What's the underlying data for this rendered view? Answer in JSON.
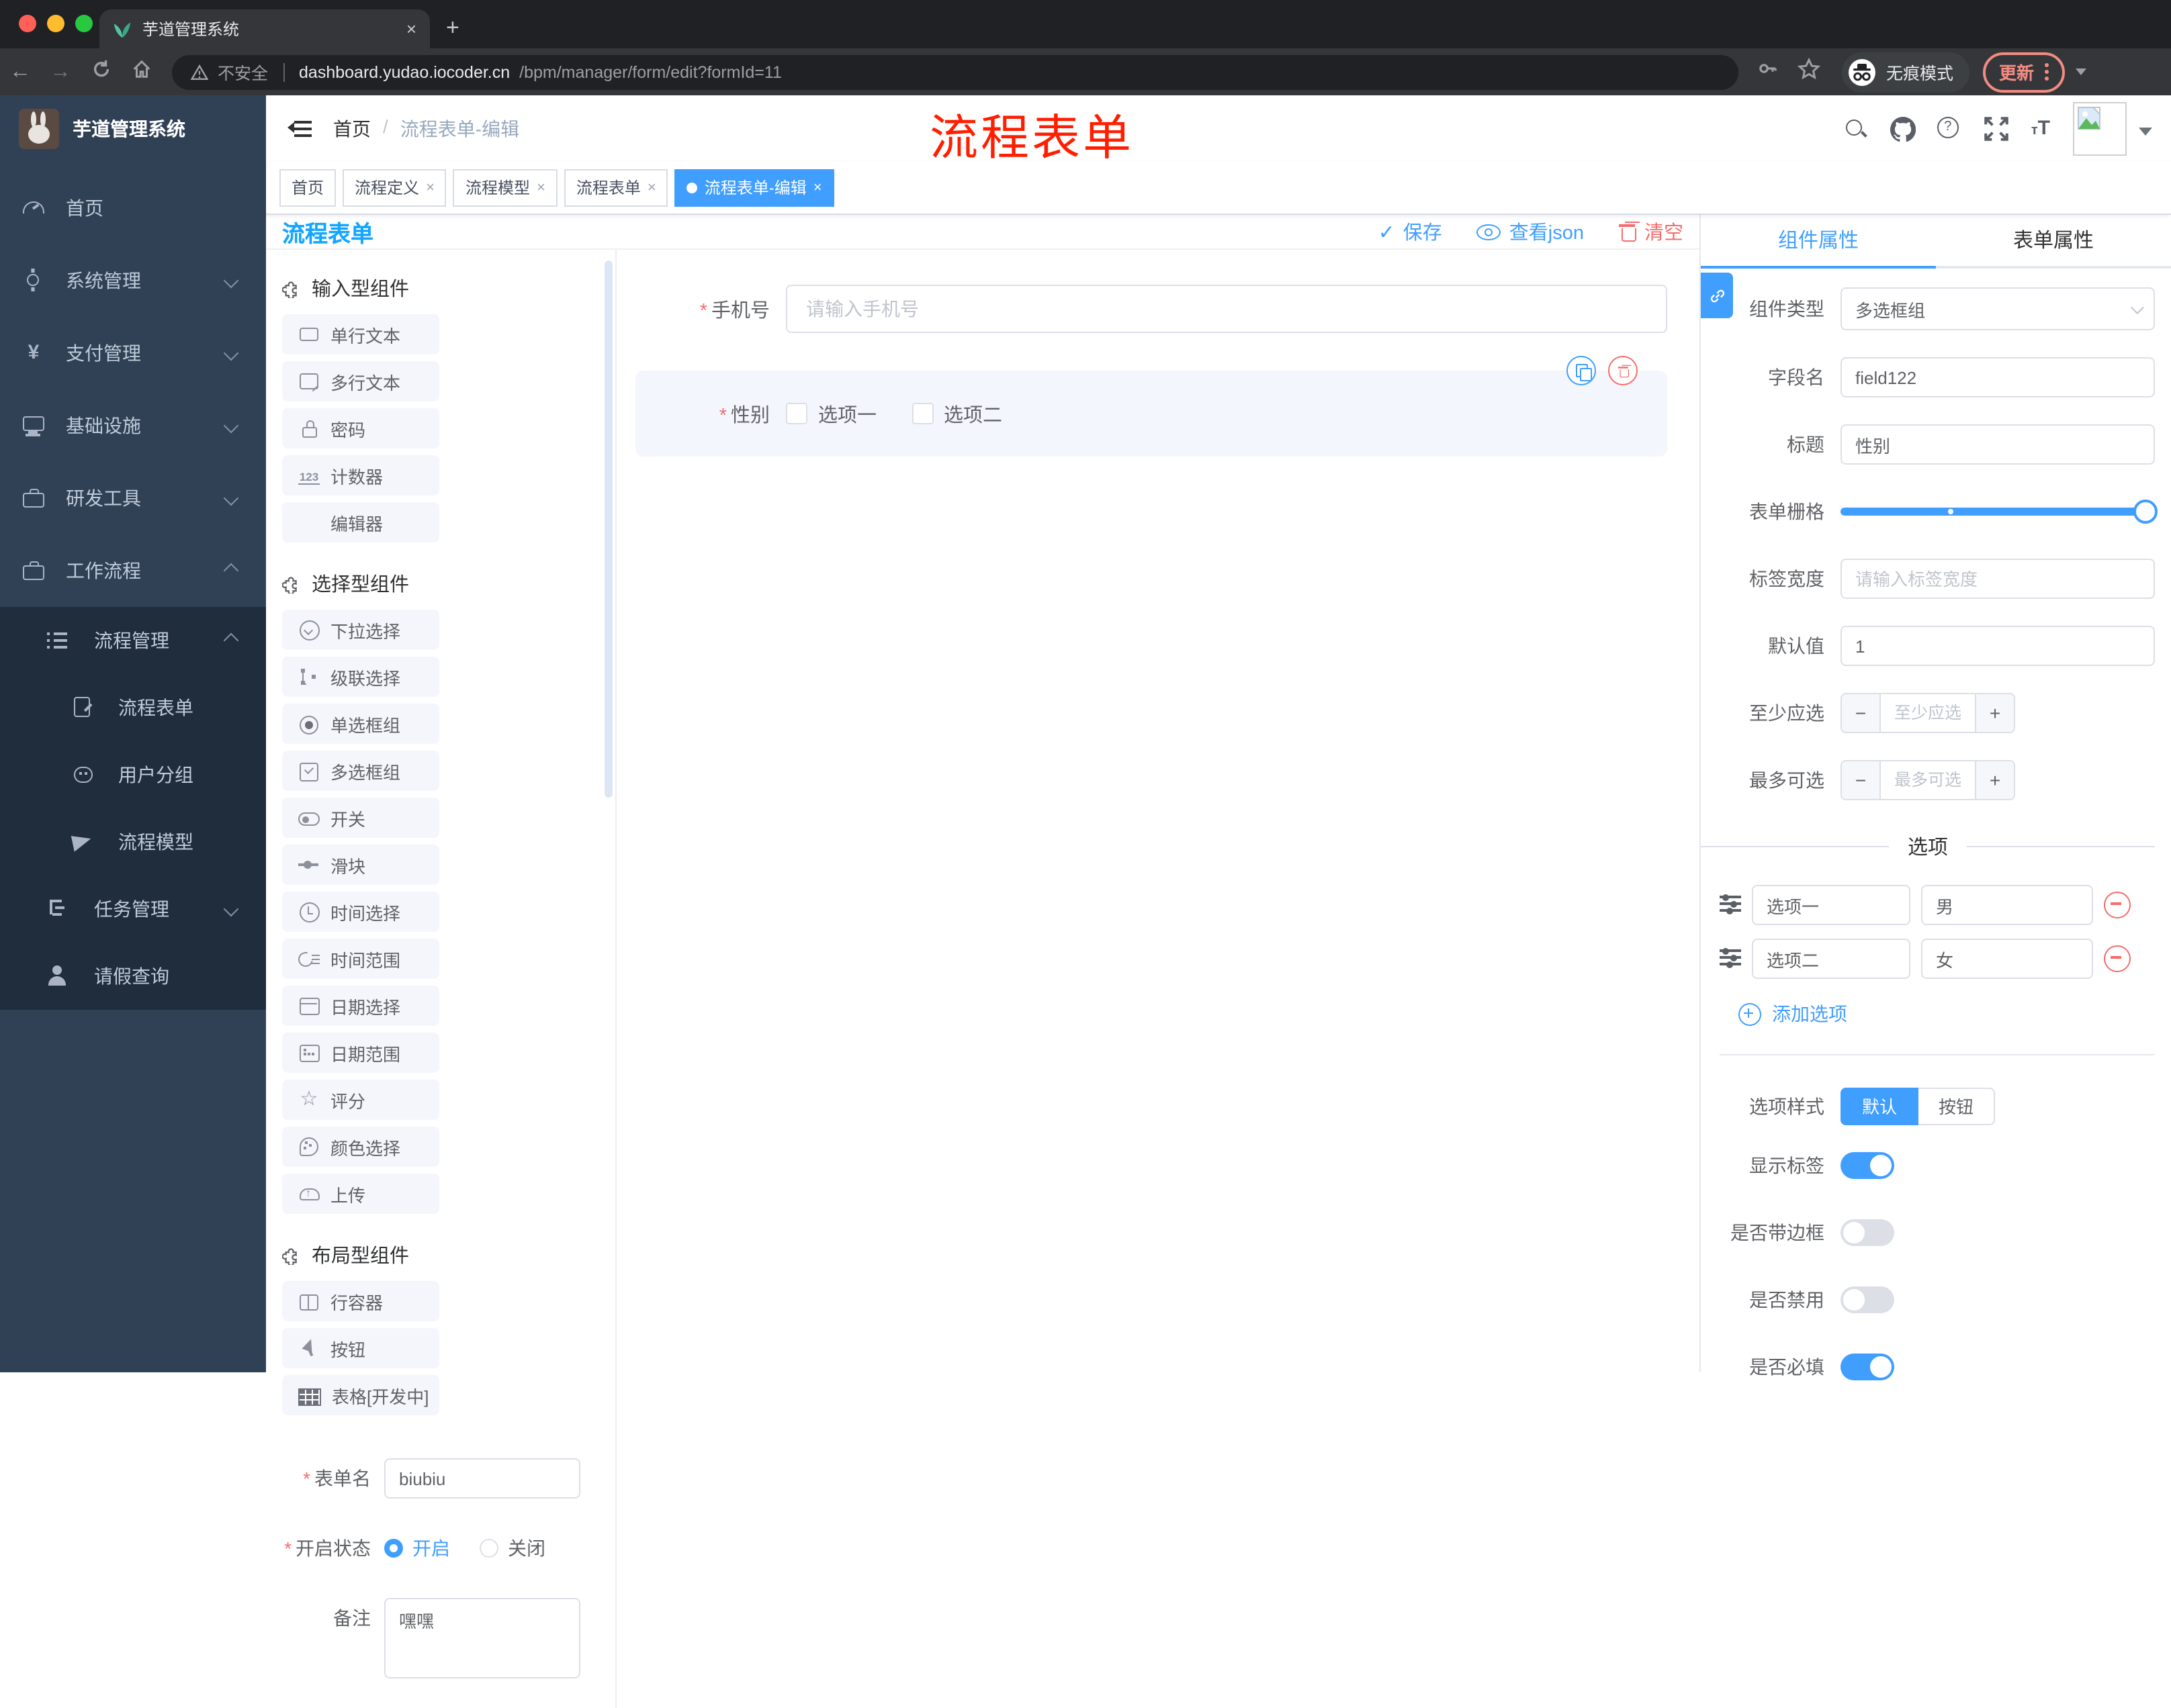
{
  "misc": {
    "required": "*",
    "close": "×",
    "newtab": "+",
    "back": "←",
    "forward": "→",
    "slash": "/",
    "minus": "−",
    "plus": "+",
    "counter_glyph": "123",
    "star_glyph": "☆",
    "font_glyph_small": "т",
    "font_glyph_big": "T"
  },
  "colors": {
    "primary": "#409EFF",
    "danger": "#F56C6C",
    "annotation_red": "#FF1E00",
    "sidebar_bg": "#304156",
    "submenu_bg": "#1F2D3D",
    "chip_bg": "#F4F6FC",
    "tag_active": "#409EFF"
  },
  "browser": {
    "tab_title": "芋道管理系统",
    "security_label": "不安全",
    "url_domain": "dashboard.yudao.iocoder.cn",
    "url_path": "/bpm/manager/form/edit?formId=11",
    "incognito_label": "无痕模式",
    "update_label": "更新"
  },
  "sidebar": {
    "logo_title": "芋道管理系统",
    "menu": [
      {
        "label": "首页"
      },
      {
        "label": "系统管理"
      },
      {
        "label": "支付管理"
      },
      {
        "label": "基础设施"
      },
      {
        "label": "研发工具"
      },
      {
        "label": "工作流程"
      }
    ],
    "submenu": [
      {
        "label": "流程管理"
      },
      {
        "label": "流程表单"
      },
      {
        "label": "用户分组"
      },
      {
        "label": "流程模型"
      },
      {
        "label": "任务管理"
      },
      {
        "label": "请假查询"
      }
    ]
  },
  "header": {
    "breadcrumb_home": "首页",
    "breadcrumb_current": "流程表单-编辑",
    "annotation": "流程表单"
  },
  "tags": [
    {
      "label": "首页"
    },
    {
      "label": "流程定义"
    },
    {
      "label": "流程模型"
    },
    {
      "label": "流程表单"
    },
    {
      "label": "流程表单-编辑"
    }
  ],
  "toolbar": {
    "title": "流程表单",
    "save": "保存",
    "view_json": "查看json",
    "clear": "清空"
  },
  "palette": {
    "sections": [
      {
        "title": "输入型组件",
        "items": [
          {
            "icon": "input",
            "label": "单行文本"
          },
          {
            "icon": "textarea",
            "label": "多行文本"
          },
          {
            "icon": "lock",
            "label": "密码"
          },
          {
            "icon": "counter",
            "label": "计数器"
          },
          {
            "icon": "none",
            "label": "编辑器"
          }
        ]
      },
      {
        "title": "选择型组件",
        "items": [
          {
            "icon": "select",
            "label": "下拉选择"
          },
          {
            "icon": "cascader",
            "label": "级联选择"
          },
          {
            "icon": "radio",
            "label": "单选框组"
          },
          {
            "icon": "checkbox",
            "label": "多选框组"
          },
          {
            "icon": "switch",
            "label": "开关"
          },
          {
            "icon": "slider",
            "label": "滑块"
          },
          {
            "icon": "clock",
            "label": "时间选择"
          },
          {
            "icon": "time-range",
            "label": "时间范围"
          },
          {
            "icon": "calendar",
            "label": "日期选择"
          },
          {
            "icon": "date-range",
            "label": "日期范围"
          },
          {
            "icon": "star",
            "label": "评分"
          },
          {
            "icon": "palette",
            "label": "颜色选择"
          },
          {
            "icon": "upload",
            "label": "上传"
          }
        ]
      },
      {
        "title": "布局型组件",
        "items": [
          {
            "icon": "row-container",
            "label": "行容器"
          },
          {
            "icon": "click",
            "label": "按钮"
          },
          {
            "icon": "table",
            "label": "表格[开发中]"
          }
        ]
      }
    ],
    "form_meta": {
      "name_label": "表单名",
      "name_value": "biubiu",
      "status_label": "开启状态",
      "status_on": "开启",
      "status_off": "关闭",
      "remark_label": "备注",
      "remark_value": "嘿嘿"
    }
  },
  "canvas": {
    "phone_label": "手机号",
    "phone_placeholder": "请输入手机号",
    "gender_label": "性别",
    "gender_option1": "选项一",
    "gender_option2": "选项二"
  },
  "inspector": {
    "tab_component": "组件属性",
    "tab_form": "表单属性",
    "type_label": "组件类型",
    "type_value": "多选框组",
    "field_label": "字段名",
    "field_value": "field122",
    "title_label": "标题",
    "title_value": "性别",
    "grid_label": "表单栅格",
    "width_label": "标签宽度",
    "width_placeholder": "请输入标签宽度",
    "default_label": "默认值",
    "default_value": "1",
    "min_label": "至少应选",
    "min_placeholder": "至少应选",
    "max_label": "最多可选",
    "max_placeholder": "最多可选",
    "options_title": "选项",
    "options": [
      {
        "label": "选项一",
        "value": "男"
      },
      {
        "label": "选项二",
        "value": "女"
      }
    ],
    "add_option": "添加选项",
    "style_label": "选项样式",
    "style_default": "默认",
    "style_button": "按钮",
    "switch_show_label": "显示标签",
    "switch_border": "是否带边框",
    "switch_disabled": "是否禁用",
    "switch_required": "是否必填"
  }
}
